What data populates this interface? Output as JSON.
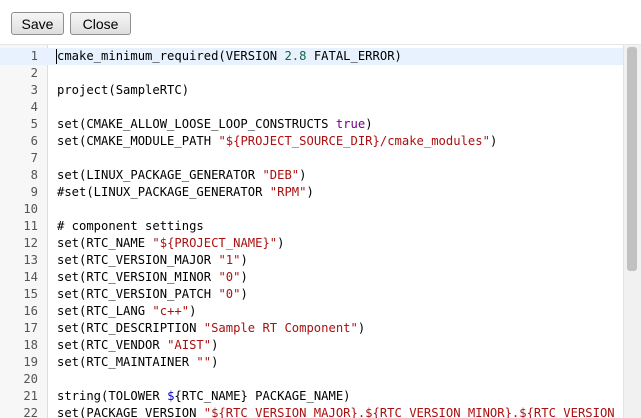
{
  "toolbar": {
    "save_label": "Save",
    "close_label": "Close"
  },
  "editor": {
    "active_line": 1,
    "lines": [
      {
        "n": "1",
        "tokens": [
          {
            "t": "cmake_minimum_required(VERSION ",
            "c": "plain"
          },
          {
            "t": "2.8",
            "c": "num"
          },
          {
            "t": " FATAL_ERROR)",
            "c": "plain"
          }
        ]
      },
      {
        "n": "2",
        "tokens": []
      },
      {
        "n": "3",
        "tokens": [
          {
            "t": "project(SampleRTC)",
            "c": "plain"
          }
        ]
      },
      {
        "n": "4",
        "tokens": []
      },
      {
        "n": "5",
        "tokens": [
          {
            "t": "set(CMAKE_ALLOW_LOOSE_LOOP_CONSTRUCTS ",
            "c": "plain"
          },
          {
            "t": "true",
            "c": "kw"
          },
          {
            "t": ")",
            "c": "plain"
          }
        ]
      },
      {
        "n": "6",
        "tokens": [
          {
            "t": "set(CMAKE_MODULE_PATH ",
            "c": "plain"
          },
          {
            "t": "\"${PROJECT_SOURCE_DIR}/cmake_modules\"",
            "c": "str"
          },
          {
            "t": ")",
            "c": "plain"
          }
        ]
      },
      {
        "n": "7",
        "tokens": []
      },
      {
        "n": "8",
        "tokens": [
          {
            "t": "set(LINUX_PACKAGE_GENERATOR ",
            "c": "plain"
          },
          {
            "t": "\"DEB\"",
            "c": "str"
          },
          {
            "t": ")",
            "c": "plain"
          }
        ]
      },
      {
        "n": "9",
        "tokens": [
          {
            "t": "#set(LINUX_PACKAGE_GENERATOR ",
            "c": "plain"
          },
          {
            "t": "\"RPM\"",
            "c": "str"
          },
          {
            "t": ")",
            "c": "plain"
          }
        ]
      },
      {
        "n": "10",
        "tokens": []
      },
      {
        "n": "11",
        "tokens": [
          {
            "t": "# component settings",
            "c": "com"
          }
        ]
      },
      {
        "n": "12",
        "tokens": [
          {
            "t": "set(RTC_NAME ",
            "c": "plain"
          },
          {
            "t": "\"${PROJECT_NAME}\"",
            "c": "str"
          },
          {
            "t": ")",
            "c": "plain"
          }
        ]
      },
      {
        "n": "13",
        "tokens": [
          {
            "t": "set(RTC_VERSION_MAJOR ",
            "c": "plain"
          },
          {
            "t": "\"1\"",
            "c": "str"
          },
          {
            "t": ")",
            "c": "plain"
          }
        ]
      },
      {
        "n": "14",
        "tokens": [
          {
            "t": "set(RTC_VERSION_MINOR ",
            "c": "plain"
          },
          {
            "t": "\"0\"",
            "c": "str"
          },
          {
            "t": ")",
            "c": "plain"
          }
        ]
      },
      {
        "n": "15",
        "tokens": [
          {
            "t": "set(RTC_VERSION_PATCH ",
            "c": "plain"
          },
          {
            "t": "\"0\"",
            "c": "str"
          },
          {
            "t": ")",
            "c": "plain"
          }
        ]
      },
      {
        "n": "16",
        "tokens": [
          {
            "t": "set(RTC_LANG ",
            "c": "plain"
          },
          {
            "t": "\"c++\"",
            "c": "str"
          },
          {
            "t": ")",
            "c": "plain"
          }
        ]
      },
      {
        "n": "17",
        "tokens": [
          {
            "t": "set(RTC_DESCRIPTION ",
            "c": "plain"
          },
          {
            "t": "\"Sample RT Component\"",
            "c": "str"
          },
          {
            "t": ")",
            "c": "plain"
          }
        ]
      },
      {
        "n": "18",
        "tokens": [
          {
            "t": "set(RTC_VENDOR ",
            "c": "plain"
          },
          {
            "t": "\"AIST\"",
            "c": "str"
          },
          {
            "t": ")",
            "c": "plain"
          }
        ]
      },
      {
        "n": "19",
        "tokens": [
          {
            "t": "set(RTC_MAINTAINER ",
            "c": "plain"
          },
          {
            "t": "\"\"",
            "c": "str"
          },
          {
            "t": ")",
            "c": "plain"
          }
        ]
      },
      {
        "n": "20",
        "tokens": []
      },
      {
        "n": "21",
        "tokens": [
          {
            "t": "string(TOLOWER ",
            "c": "plain"
          },
          {
            "t": "$",
            "c": "var"
          },
          {
            "t": "{RTC_NAME} PACKAGE_NAME)",
            "c": "plain"
          }
        ]
      },
      {
        "n": "22",
        "tokens": [
          {
            "t": "set(PACKAGE_VERSION ",
            "c": "plain"
          },
          {
            "t": "\"${RTC_VERSION_MAJOR}.${RTC_VERSION_MINOR}.${RTC_VERSION_PATCH}\"",
            "c": "str"
          }
        ]
      }
    ]
  },
  "colors": {
    "plain": "#000000",
    "str": "#aa1111",
    "num": "#116644",
    "kw": "#770088",
    "var": "#0000cc",
    "com": "#000000",
    "active_line_bg": "#e8f2ff"
  }
}
